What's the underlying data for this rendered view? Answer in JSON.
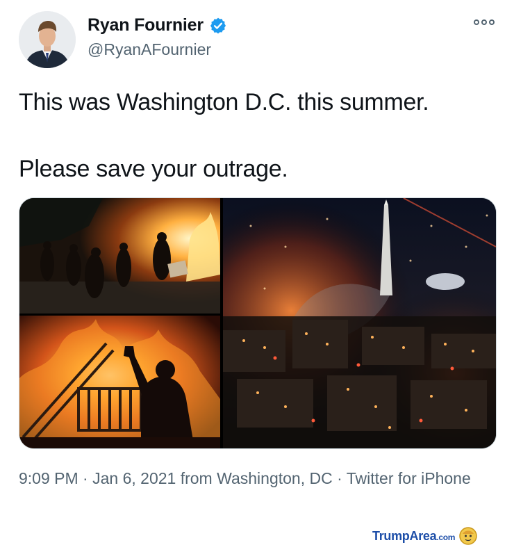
{
  "author": {
    "display_name": "Ryan Fournier",
    "handle": "@RyanAFournier",
    "verified_icon": "verified-badge-icon",
    "accent_color": "#1d9bf0"
  },
  "tweet": {
    "lines": [
      "This was Washington D.C. this summer.",
      "Please save your outrage."
    ]
  },
  "media": {
    "count": 3,
    "icons": [
      "photo-protest-street",
      "photo-fire-barricade",
      "photo-night-city-fires"
    ]
  },
  "meta": {
    "time": "9:09 PM",
    "sep1": "·",
    "date": "Jan 6, 2021",
    "from": "from",
    "location": "Washington, DC",
    "sep2": "·",
    "source": "Twitter for iPhone"
  },
  "watermark": {
    "brand_a": "Trump",
    "brand_b": "Area",
    "brand_c": ".com"
  }
}
